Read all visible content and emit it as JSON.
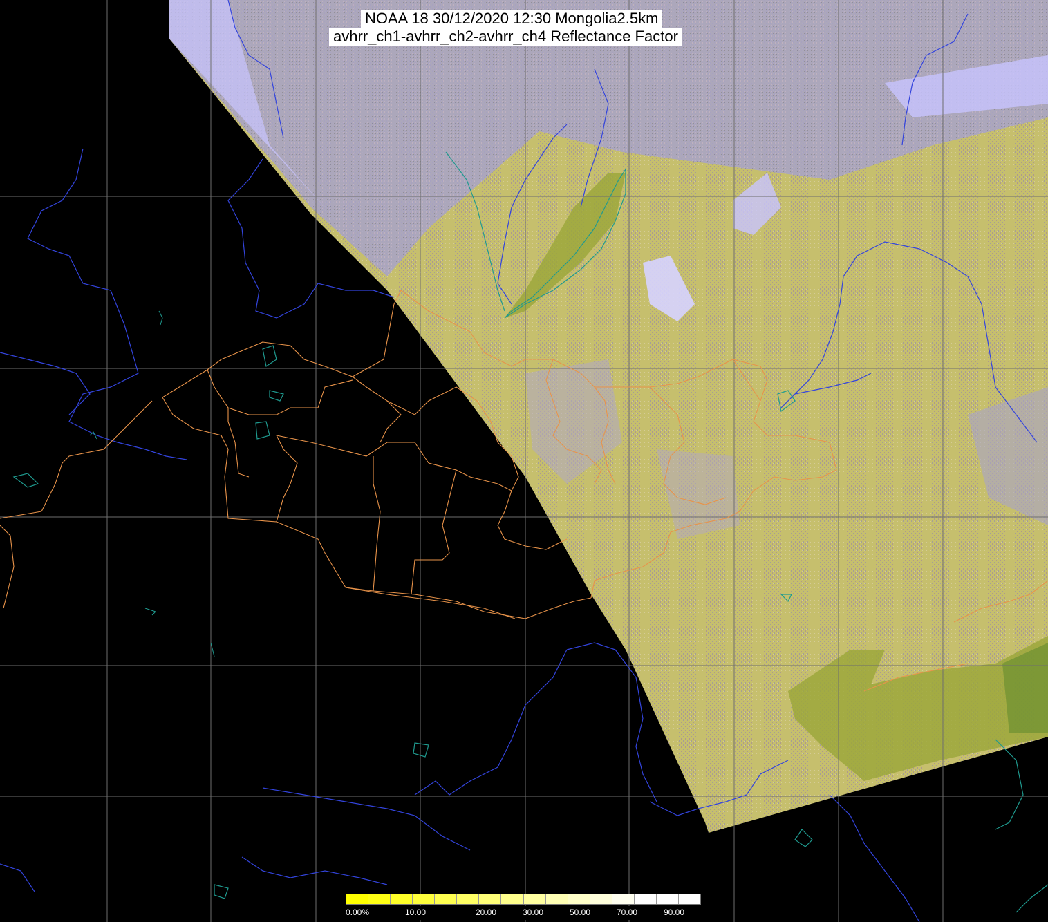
{
  "title": {
    "line1": "NOAA 18 30/12/2020 12:30 Mongolia2.5km",
    "line2": "avhrr_ch1-avhrr_ch2-avhrr_ch4 Reflectance Factor"
  },
  "map": {
    "background_color": "#000000",
    "grid_color": "#6e6e6e",
    "river_color": "#3344dd",
    "lake_outline_color": "#1f9a8f",
    "border_color": "#e8934a",
    "swath_fill_color": "#c7c06e",
    "cloud_color": "#b9b6e6",
    "mountain_color": "#9ea83a"
  },
  "legend": {
    "colors": [
      "#ffff00",
      "#ffff14",
      "#ffff28",
      "#ffff3c",
      "#ffff50",
      "#ffff64",
      "#ffff78",
      "#ffff8c",
      "#ffffa0",
      "#ffffb4",
      "#ffffc8",
      "#ffffdc",
      "#fffff0",
      "#ffffff",
      "#ffffff",
      "#ffffff"
    ],
    "labels": [
      "0.00%",
      "10.00",
      "20.00",
      "30.00",
      "50.00",
      "70.00",
      "90.00"
    ]
  }
}
